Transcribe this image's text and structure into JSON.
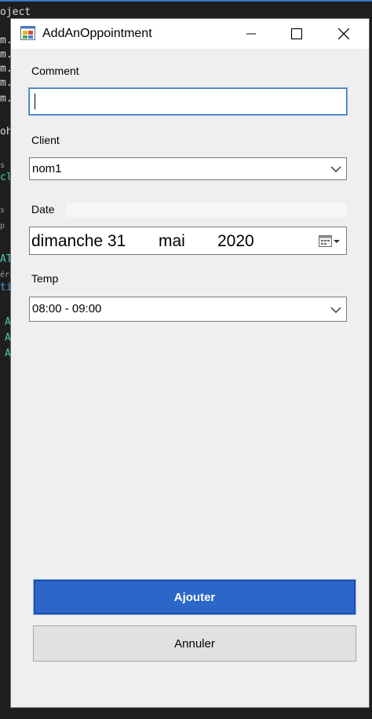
{
  "background_ide": {
    "lines": [
      "oject",
      "m.",
      "m.",
      "m.",
      "m.",
      "m.",
      "oh",
      "s",
      "cl",
      "s",
      "p",
      "AT",
      "ére",
      "ti:",
      "A",
      "A",
      "A"
    ]
  },
  "window": {
    "title": "AddAnOppointment",
    "icon": "form-app-icon",
    "minimize_icon": "minimize-icon",
    "maximize_icon": "maximize-icon",
    "close_icon": "close-icon"
  },
  "form": {
    "comment_label": "Comment",
    "comment_value": "",
    "client_label": "Client",
    "client_value": "nom1",
    "date_label": "Date",
    "date_day": "dimanche 31",
    "date_month": "mai",
    "date_year": "2020",
    "temp_label": "Temp",
    "temp_value": "08:00 - 09:00"
  },
  "buttons": {
    "ajouter": "Ajouter",
    "annuler": "Annuler"
  },
  "colors": {
    "accent": "#2b66c8",
    "focus_border": "#3a76c4",
    "window_bg": "#efefef"
  }
}
